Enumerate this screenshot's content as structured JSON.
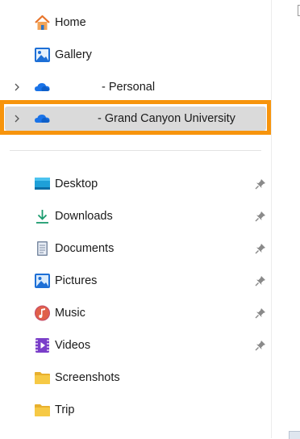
{
  "nav": {
    "home": {
      "label": "Home",
      "icon": "home-icon"
    },
    "gallery": {
      "label": "Gallery",
      "icon": "gallery-icon"
    },
    "onedrive_personal": {
      "label": "- Personal",
      "icon": "onedrive-cloud-icon"
    },
    "onedrive_work": {
      "label": "- Grand Canyon University",
      "icon": "onedrive-cloud-icon",
      "selected": true
    },
    "quick_access": [
      {
        "label": "Desktop",
        "icon": "desktop-icon",
        "pinned": true
      },
      {
        "label": "Downloads",
        "icon": "downloads-icon",
        "pinned": true
      },
      {
        "label": "Documents",
        "icon": "documents-icon",
        "pinned": true
      },
      {
        "label": "Pictures",
        "icon": "pictures-icon",
        "pinned": true
      },
      {
        "label": "Music",
        "icon": "music-icon",
        "pinned": true
      },
      {
        "label": "Videos",
        "icon": "videos-icon",
        "pinned": true
      },
      {
        "label": "Screenshots",
        "icon": "folder-icon",
        "pinned": false
      },
      {
        "label": "Trip",
        "icon": "folder-icon",
        "pinned": false
      }
    ]
  },
  "colors": {
    "highlight_border": "#f7940c",
    "selected_bg": "#dadada",
    "onedrive_blue": "#1a73e8",
    "folder_yellow": "#f4c542"
  }
}
